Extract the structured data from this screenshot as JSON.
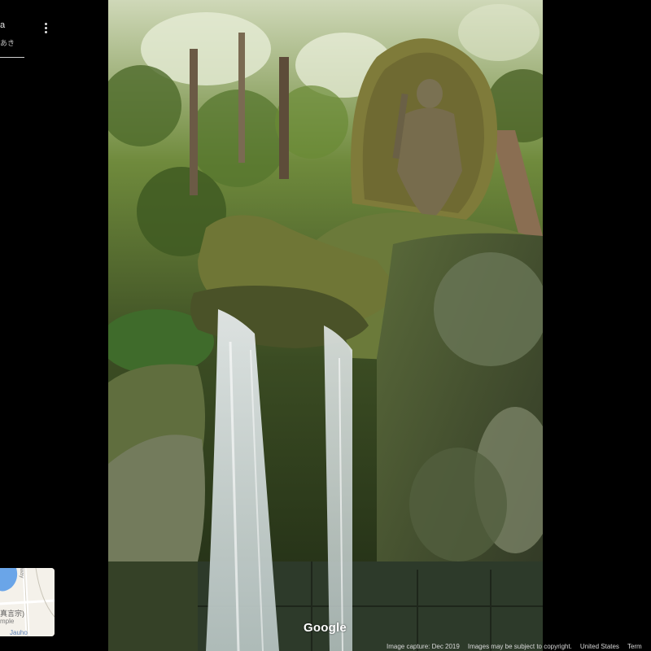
{
  "place": {
    "title": "a",
    "subtitle": "あき"
  },
  "minimap": {
    "label_line1": "真言宗)",
    "label_line2": "mple",
    "label_line3": "Jauho",
    "road_label": "way"
  },
  "branding": {
    "logo": "Google"
  },
  "footer": {
    "capture_date": "Image capture: Dec 2019",
    "copyright": "Images may be subject to copyright.",
    "region": "United States",
    "terms": "Term"
  },
  "icons": {
    "more": "more-vert-icon"
  },
  "colors": {
    "background": "#000000",
    "water_blue": "#6aa5e8",
    "minimap_land": "#f4f1ea"
  }
}
